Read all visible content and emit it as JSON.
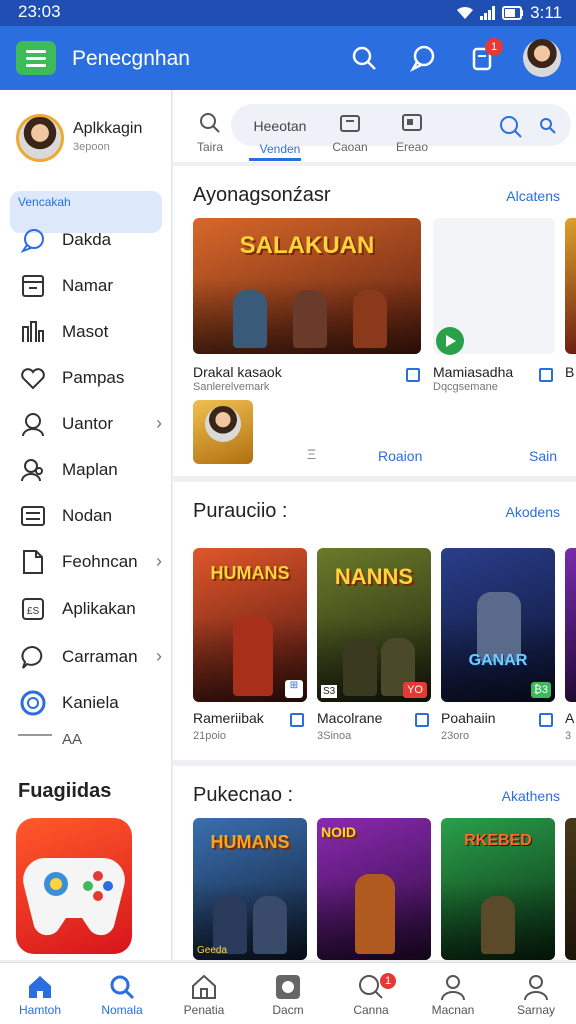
{
  "status_bar": {
    "time": "23:03",
    "right_time": "3:11"
  },
  "app_bar": {
    "title": "Penecgnhan",
    "notification_badge": "1"
  },
  "sidebar": {
    "profile": {
      "name": "Aplkkagin",
      "subtitle": "3epoon"
    },
    "highlight_label": "Vencakah",
    "items": [
      {
        "label": "Dakda",
        "icon": "chat-icon"
      },
      {
        "label": "Namar",
        "icon": "calendar-icon"
      },
      {
        "label": "Masot",
        "icon": "chart-icon"
      },
      {
        "label": "Pampas",
        "icon": "heart-icon"
      },
      {
        "label": "Uantor",
        "icon": "person-icon",
        "chevron": true
      },
      {
        "label": "Maplan",
        "icon": "people-icon"
      },
      {
        "label": "Nodan",
        "icon": "list-icon"
      },
      {
        "label": "Feohncan",
        "icon": "document-icon",
        "chevron": true
      },
      {
        "label": "Aplikakan",
        "icon": "apps-icon"
      },
      {
        "label": "Carraman",
        "icon": "bubble-icon",
        "chevron": true
      },
      {
        "label": "Kaniela",
        "icon": "circle-icon"
      }
    ],
    "partial_item": "AA",
    "section_title": "Fuagiidas"
  },
  "tabs": [
    {
      "label": "Taira"
    },
    {
      "label": "Venden",
      "top": "Heeotan"
    },
    {
      "label": "Caoan"
    },
    {
      "label": "Ereao"
    }
  ],
  "sections": [
    {
      "title": "Ayonagsonźasr",
      "more": "Alcatens",
      "featured": {
        "logo": "SALAKUAN",
        "title": "Drakal kasaok",
        "sub": "Sanlerelvemark"
      },
      "second": {
        "title": "Mamiasadha",
        "sub": "Dqcgsemane"
      },
      "third_partial": "B",
      "footer_left": "Ξ",
      "footer_mid": "Roaion",
      "footer_right": "Sain"
    },
    {
      "title": "Purauciio :",
      "more": "Akodens",
      "cards": [
        {
          "logo": "HUMANS",
          "title": "Rameriibak",
          "sub": "21poio",
          "colors": [
            "#e0562a",
            "#4a1410"
          ],
          "badge": "🎮"
        },
        {
          "logo": "NANNS",
          "title": "Macolrane",
          "sub": "3Sinoa",
          "badge_text": "YO",
          "colors": [
            "#6b7a2a",
            "#1c2410"
          ],
          "corner": "S3"
        },
        {
          "logo": "GANAR",
          "title": "Poahaiin",
          "sub": "23oro",
          "badge_text": "₿3",
          "colors": [
            "#2a3e8a",
            "#0c1230"
          ]
        },
        {
          "title": "A",
          "sub": "3",
          "colors": [
            "#7a2ab0",
            "#200a30"
          ]
        }
      ]
    },
    {
      "title": "Pukecnao :",
      "more": "Akathens",
      "cards": [
        {
          "logo": "HUMANS",
          "colors": [
            "#3a6fb0",
            "#101c30"
          ],
          "corner": "Geeda"
        },
        {
          "logo": "NOID",
          "colors": [
            "#8a2ab0",
            "#2a0a3a"
          ]
        },
        {
          "logo": "RKEBED",
          "colors": [
            "#2aa04a",
            "#0a2a12"
          ]
        },
        {
          "colors": [
            "#4a3a1a",
            "#1a1208"
          ]
        }
      ]
    }
  ],
  "bottom_nav": [
    {
      "label": "Hamtoh",
      "icon": "home-icon",
      "active": true
    },
    {
      "label": "Nomala",
      "icon": "search-icon",
      "active": true
    },
    {
      "label": "Penatia",
      "icon": "house-icon"
    },
    {
      "label": "Dacm",
      "icon": "camera-icon"
    },
    {
      "label": "Canna",
      "icon": "search-alert-icon",
      "badge": "1"
    },
    {
      "label": "Macnan",
      "icon": "person-icon"
    },
    {
      "label": "Sarnay",
      "icon": "profile-icon"
    }
  ],
  "colors": {
    "primary": "#2a6ee0",
    "status_bar": "#1f4fb3",
    "menu_button": "#3dbb5a",
    "badge": "#e53935"
  }
}
